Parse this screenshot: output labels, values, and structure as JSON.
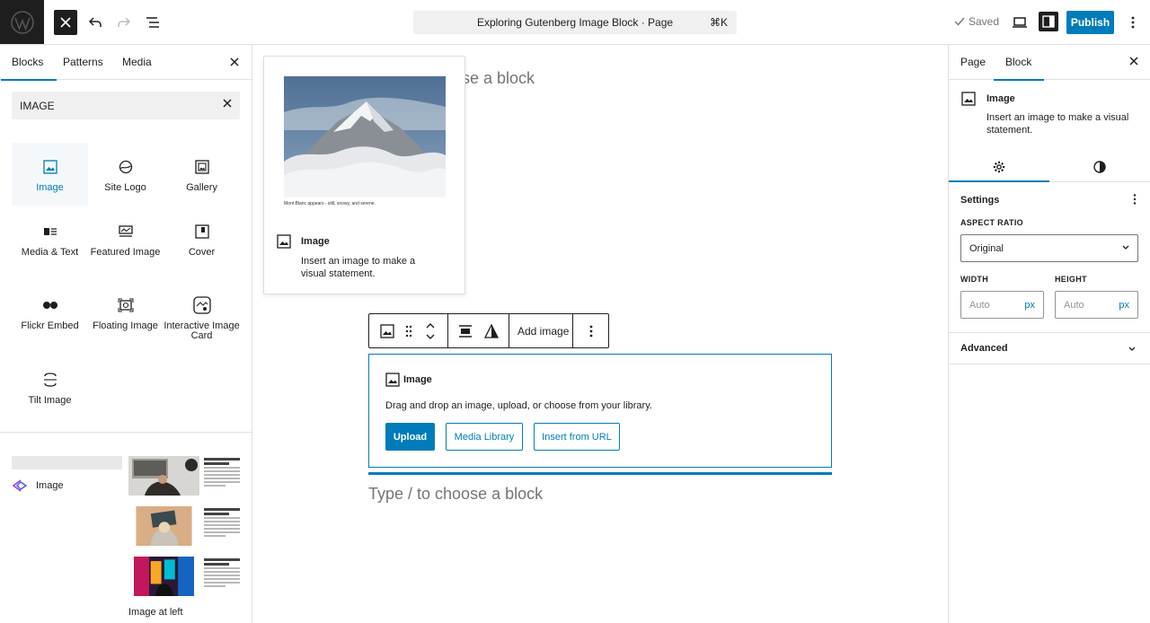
{
  "topbar": {
    "doc_title": "Exploring Gutenberg Image Block · Page",
    "shortcut": "⌘K",
    "saved_label": "Saved",
    "publish_label": "Publish"
  },
  "inserter": {
    "tabs": [
      "Blocks",
      "Patterns",
      "Media"
    ],
    "search_value": "IMAGE",
    "blocks": [
      {
        "label": "Image",
        "icon": "image-icon"
      },
      {
        "label": "Site Logo",
        "icon": "site-logo-icon"
      },
      {
        "label": "Gallery",
        "icon": "gallery-icon"
      },
      {
        "label": "Media & Text",
        "icon": "media-text-icon"
      },
      {
        "label": "Featured Image",
        "icon": "featured-image-icon"
      },
      {
        "label": "Cover",
        "icon": "cover-icon"
      },
      {
        "label": "Flickr Embed",
        "icon": "flickr-icon"
      },
      {
        "label": "Floating Image",
        "icon": "floating-image-icon"
      },
      {
        "label": "Interactive Image Card",
        "icon": "interactive-image-card-icon"
      },
      {
        "label": "Tilt Image",
        "icon": "tilt-image-icon"
      }
    ],
    "pattern_category": "Image",
    "pattern_caption": "Image at left"
  },
  "canvas": {
    "ghost_top": "ose a block",
    "preview": {
      "caption": "Mont Blanc appears - still, snowy, and serene.",
      "title": "Image",
      "description": "Insert an image to make a visual statement."
    },
    "toolbar": {
      "add_image_label": "Add image"
    },
    "placeholder": {
      "title": "Image",
      "instructions": "Drag and drop an image, upload, or choose from your library.",
      "upload_label": "Upload",
      "media_library_label": "Media Library",
      "insert_url_label": "Insert from URL"
    },
    "ghost_bottom": "Type / to choose a block"
  },
  "settings": {
    "tabs": [
      "Page",
      "Block"
    ],
    "block_title": "Image",
    "block_desc": "Insert an image to make a visual statement.",
    "panel_title": "Settings",
    "aspect_ratio_label": "ASPECT RATIO",
    "aspect_ratio_value": "Original",
    "width_label": "WIDTH",
    "height_label": "HEIGHT",
    "width_placeholder": "Auto",
    "height_placeholder": "Auto",
    "unit": "px",
    "advanced_label": "Advanced"
  },
  "colors": {
    "accent": "#007cba",
    "dark": "#1e1e1e"
  }
}
